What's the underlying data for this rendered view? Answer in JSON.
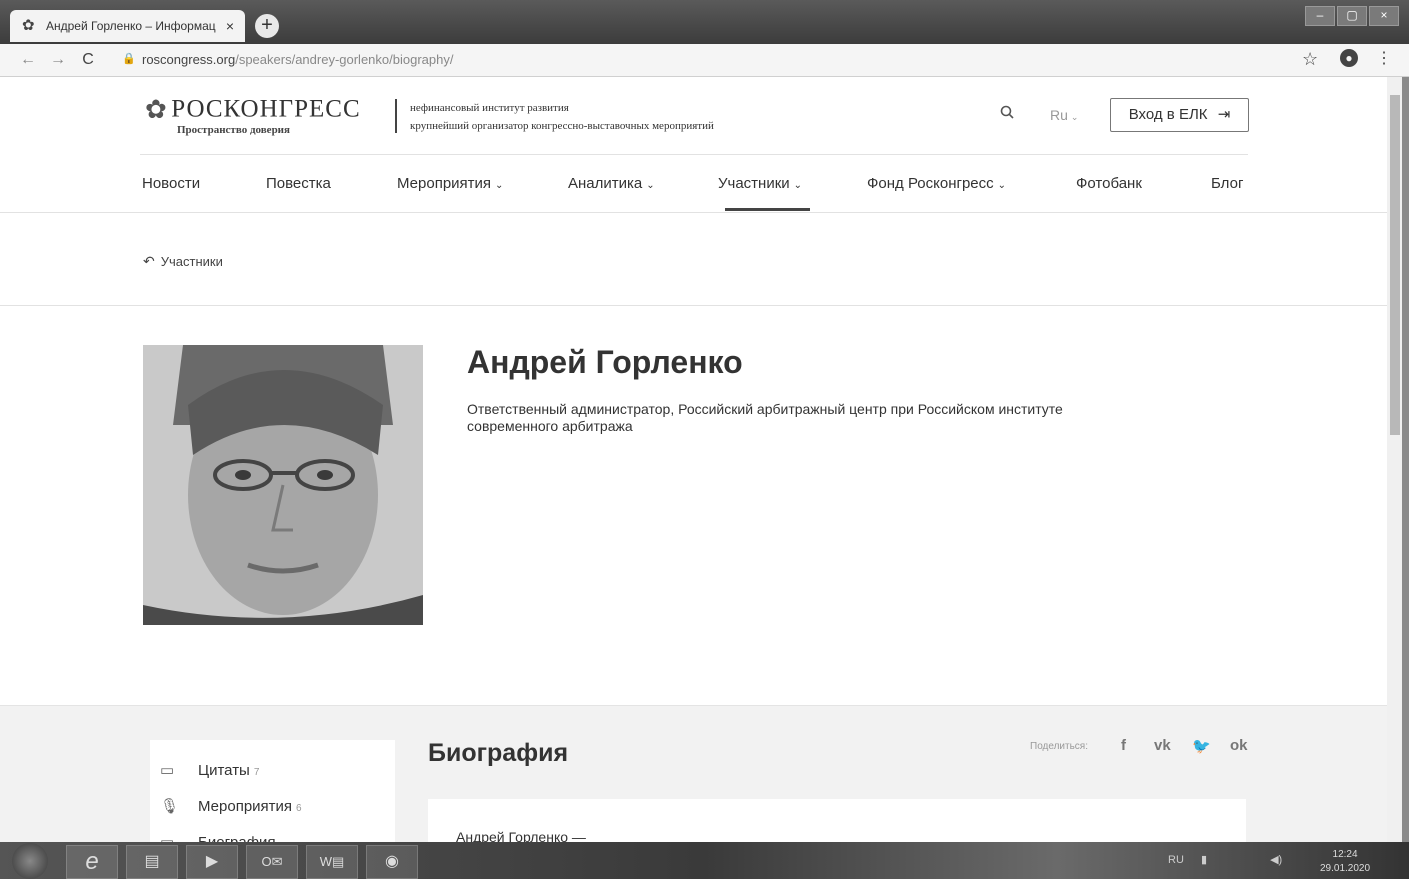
{
  "browser": {
    "tab_title": "Андрей Горленко – Информац",
    "url_domain": "roscongress.org",
    "url_path": "/speakers/andrey-gorlenko/biography/"
  },
  "header": {
    "logo_name": "РОСКОНГРЕСС",
    "logo_sub": "Пространство доверия",
    "tagline1": "нефинансовый институт развития",
    "tagline2": "крупнейший организатор конгрессно-выставочных мероприятий",
    "lang": "Ru",
    "login": "Вход в ЕЛК"
  },
  "nav": [
    {
      "label": "Новости",
      "name": "nav-news"
    },
    {
      "label": "Повестка",
      "name": "nav-agenda"
    },
    {
      "label": "Мероприятия",
      "name": "nav-events"
    },
    {
      "label": "Аналитика",
      "name": "nav-analytics"
    },
    {
      "label": "Участники",
      "name": "nav-participants"
    },
    {
      "label": "Фонд Росконгресс",
      "name": "nav-foundation"
    },
    {
      "label": "Фотобанк",
      "name": "nav-photobank"
    },
    {
      "label": "Блог",
      "name": "nav-blog"
    }
  ],
  "breadcrumb": {
    "back_label": "Участники"
  },
  "profile": {
    "name": "Андрей Горленко",
    "position": "Ответственный администратор, Российский арбитражный центр при Российском институте современного арбитража"
  },
  "sidebar": {
    "items": [
      {
        "label": "Цитаты",
        "count": "7"
      },
      {
        "label": "Мероприятия",
        "count": "6"
      },
      {
        "label": "Биография",
        "count": ""
      }
    ]
  },
  "biography": {
    "heading": "Биография",
    "share_label": "Поделиться:",
    "text": "Андрей Горленко —"
  },
  "taskbar": {
    "lang": "RU",
    "time": "12:24",
    "date": "29.01.2020"
  }
}
